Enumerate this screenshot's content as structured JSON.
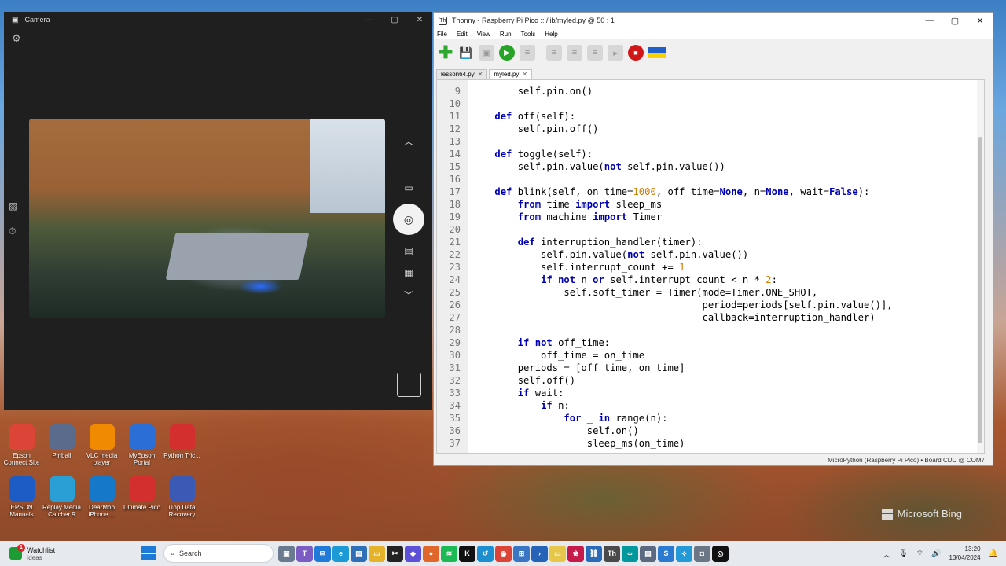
{
  "camera": {
    "title": "Camera",
    "controls": [
      "—",
      "▢",
      "✕"
    ]
  },
  "thonny": {
    "title": "Thonny  -  Raspberry Pi Pico :: /lib/myled.py  @  50 : 1",
    "controls": [
      "—",
      "▢",
      "✕"
    ],
    "menu": [
      "File",
      "Edit",
      "View",
      "Run",
      "Tools",
      "Help"
    ],
    "tabs": [
      {
        "label": "lesson64.py",
        "active": false
      },
      {
        "label": "myled.py",
        "active": true
      }
    ],
    "status": "MicroPython (Raspberry Pi Pico)  •  Board CDC @ COM7"
  },
  "code_lines": [
    {
      "n": "9",
      "text": "        self.pin.on()"
    },
    {
      "n": "10",
      "text": ""
    },
    {
      "n": "11",
      "text": "    def off(self):"
    },
    {
      "n": "12",
      "text": "        self.pin.off()"
    },
    {
      "n": "13",
      "text": ""
    },
    {
      "n": "14",
      "text": "    def toggle(self):"
    },
    {
      "n": "15",
      "text": "        self.pin.value(not self.pin.value())"
    },
    {
      "n": "16",
      "text": ""
    },
    {
      "n": "17",
      "text": "    def blink(self, on_time=1000, off_time=None, n=None, wait=False):"
    },
    {
      "n": "18",
      "text": "        from time import sleep_ms"
    },
    {
      "n": "19",
      "text": "        from machine import Timer"
    },
    {
      "n": "20",
      "text": ""
    },
    {
      "n": "21",
      "text": "        def interruption_handler(timer):"
    },
    {
      "n": "22",
      "text": "            self.pin.value(not self.pin.value())"
    },
    {
      "n": "23",
      "text": "            self.interrupt_count += 1"
    },
    {
      "n": "24",
      "text": "            if not n or self.interrupt_count < n * 2:"
    },
    {
      "n": "25",
      "text": "                self.soft_timer = Timer(mode=Timer.ONE_SHOT,"
    },
    {
      "n": "26",
      "text": "                                        period=periods[self.pin.value()],"
    },
    {
      "n": "27",
      "text": "                                        callback=interruption_handler)"
    },
    {
      "n": "28",
      "text": ""
    },
    {
      "n": "29",
      "text": "        if not off_time:"
    },
    {
      "n": "30",
      "text": "            off_time = on_time"
    },
    {
      "n": "31",
      "text": "        periods = [off_time, on_time]"
    },
    {
      "n": "32",
      "text": "        self.off()"
    },
    {
      "n": "33",
      "text": "        if wait:"
    },
    {
      "n": "34",
      "text": "            if n:"
    },
    {
      "n": "35",
      "text": "                for _ in range(n):"
    },
    {
      "n": "36",
      "text": "                    self.on()"
    },
    {
      "n": "37",
      "text": "                    sleep_ms(on_time)"
    }
  ],
  "desktop_icons": [
    {
      "label": "Epson Connect Site",
      "icon": "chrome-icon",
      "color": "#db4437"
    },
    {
      "label": "Pinball",
      "icon": "pinball-icon",
      "color": "#5a6b8c"
    },
    {
      "label": "VLC media player",
      "icon": "vlc-icon",
      "color": "#f08a00"
    },
    {
      "label": "MyEpson Portal",
      "icon": "info-icon",
      "color": "#2b6fd6"
    },
    {
      "label": "Python Tric...",
      "icon": "pdf-icon",
      "color": "#d32f2f"
    },
    {
      "label": "EPSON Manuals",
      "icon": "manual-icon",
      "color": "#1d5cc4"
    },
    {
      "label": "Replay Media Catcher 9",
      "icon": "globe-icon",
      "color": "#2a9fd6"
    },
    {
      "label": "DearMob iPhone ...",
      "icon": "dearmob-icon",
      "color": "#1578c9"
    },
    {
      "label": "Ultimate Pico",
      "icon": "pdf-icon",
      "color": "#d32f2f"
    },
    {
      "label": "iTop Data Recovery",
      "icon": "recovery-icon",
      "color": "#3b5ab5"
    }
  ],
  "bing": "Microsoft Bing",
  "taskbar": {
    "watchlist": "Watchlist",
    "watchlist_sub": "Ideas",
    "badge": "1",
    "search": "Search",
    "time": "13:20",
    "date": "13/04/2024"
  }
}
